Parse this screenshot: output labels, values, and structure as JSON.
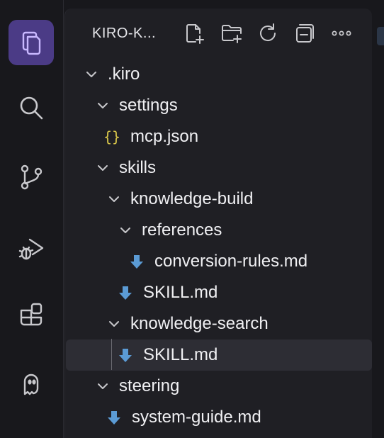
{
  "explorer": {
    "title": "KIRO-K...",
    "actions": [
      "new-file-icon",
      "new-folder-icon",
      "refresh-icon",
      "collapse-all-icon",
      "more-icon"
    ]
  },
  "activity_bar": {
    "items": [
      "explorer-icon",
      "search-icon",
      "source-control-icon",
      "run-debug-icon",
      "extensions-icon",
      "kiro-ghost-icon"
    ],
    "active": "explorer-icon",
    "accent": "#4b3b86"
  },
  "tree": {
    "kiro": ".kiro",
    "settings": "settings",
    "mcp_json": "mcp.json",
    "skills": "skills",
    "knowledge_build": "knowledge-build",
    "references": "references",
    "conversion_rules": "conversion-rules.md",
    "skill_md_1": "SKILL.md",
    "knowledge_search": "knowledge-search",
    "skill_md_2": "SKILL.md",
    "steering": "steering",
    "system_guide": "system-guide.md",
    "selected": "skill_md_2"
  },
  "colors": {
    "md_icon": "#5b9bd5",
    "json_icon": "#d8c64a",
    "text": "#f0f0f3"
  }
}
